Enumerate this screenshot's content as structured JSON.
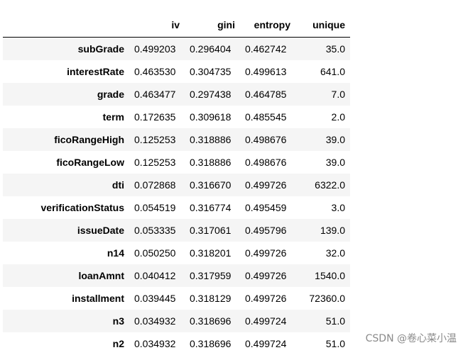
{
  "table": {
    "columns": [
      "iv",
      "gini",
      "entropy",
      "unique"
    ],
    "rows": [
      {
        "index": "subGrade",
        "iv": "0.499203",
        "gini": "0.296404",
        "entropy": "0.462742",
        "unique": "35.0"
      },
      {
        "index": "interestRate",
        "iv": "0.463530",
        "gini": "0.304735",
        "entropy": "0.499613",
        "unique": "641.0"
      },
      {
        "index": "grade",
        "iv": "0.463477",
        "gini": "0.297438",
        "entropy": "0.464785",
        "unique": "7.0"
      },
      {
        "index": "term",
        "iv": "0.172635",
        "gini": "0.309618",
        "entropy": "0.485545",
        "unique": "2.0"
      },
      {
        "index": "ficoRangeHigh",
        "iv": "0.125253",
        "gini": "0.318886",
        "entropy": "0.498676",
        "unique": "39.0"
      },
      {
        "index": "ficoRangeLow",
        "iv": "0.125253",
        "gini": "0.318886",
        "entropy": "0.498676",
        "unique": "39.0"
      },
      {
        "index": "dti",
        "iv": "0.072868",
        "gini": "0.316670",
        "entropy": "0.499726",
        "unique": "6322.0"
      },
      {
        "index": "verificationStatus",
        "iv": "0.054519",
        "gini": "0.316774",
        "entropy": "0.495459",
        "unique": "3.0"
      },
      {
        "index": "issueDate",
        "iv": "0.053335",
        "gini": "0.317061",
        "entropy": "0.495796",
        "unique": "139.0"
      },
      {
        "index": "n14",
        "iv": "0.050250",
        "gini": "0.318201",
        "entropy": "0.499726",
        "unique": "32.0"
      },
      {
        "index": "loanAmnt",
        "iv": "0.040412",
        "gini": "0.317959",
        "entropy": "0.499726",
        "unique": "1540.0"
      },
      {
        "index": "installment",
        "iv": "0.039445",
        "gini": "0.318129",
        "entropy": "0.499726",
        "unique": "72360.0"
      },
      {
        "index": "n3",
        "iv": "0.034932",
        "gini": "0.318696",
        "entropy": "0.499724",
        "unique": "51.0"
      },
      {
        "index": "n2",
        "iv": "0.034932",
        "gini": "0.318696",
        "entropy": "0.499724",
        "unique": "51.0"
      }
    ]
  },
  "watermark": "CSDN @卷心菜小温",
  "colors": {
    "stripe": "#f5f5f5",
    "header_rule": "#000000",
    "watermark": "#8a8a8a"
  }
}
